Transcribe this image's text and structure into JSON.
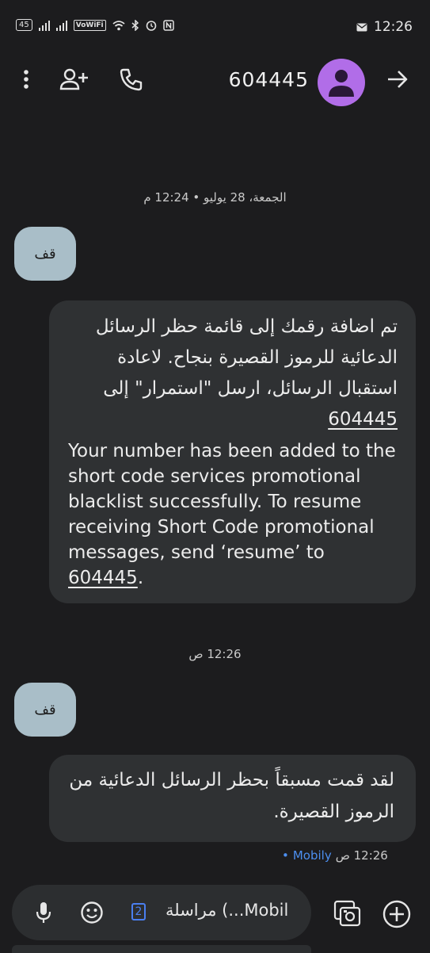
{
  "status_bar": {
    "time": "12:26",
    "badge": "45",
    "vowifi": "VoWiFi",
    "icons": [
      "signal-bars-icon",
      "signal-bars-icon",
      "wifi-icon",
      "bluetooth-icon",
      "alarm-icon",
      "nfc-icon",
      "message-icon"
    ]
  },
  "header": {
    "title": "604445",
    "icons": [
      "more-vert-icon",
      "add-person-icon",
      "phone-icon",
      "avatar-icon",
      "forward-arrow-icon"
    ]
  },
  "messages": [
    {
      "type": "date",
      "text": "الجمعة، 28 يوليو • 12:24 م"
    },
    {
      "type": "sent",
      "text": "قف"
    },
    {
      "type": "received",
      "arabic_text": "تم اضافة رقمك إلى قائمة حظر الرسائل الدعائية للرموز القصيرة بنجاح. لاعادة استقبال الرسائل، ارسل \"استمرار\" إلى",
      "arabic_number": "604445",
      "english_text": "Your number has been added to the short code services promotional blacklist successfully. To resume receiving Short Code promotional messages, send ‘resume’ to",
      "english_number": "604445",
      "english_suffix": "."
    },
    {
      "type": "date",
      "text": "12:26 ص"
    },
    {
      "type": "sent",
      "text": "قف"
    },
    {
      "type": "received",
      "text": "لقد قمت مسبقاً بحظر الرسائل الدعائية من الرموز القصيرة."
    },
    {
      "type": "meta",
      "time": "12:26 ص",
      "separator": "•",
      "carrier": "Mobily"
    }
  ],
  "compose": {
    "sim_number": "2",
    "placeholder": "مراسلة (...Mobil",
    "icons": [
      "mic-icon",
      "emoji-icon",
      "sim-card-icon",
      "gallery-icon",
      "add-icon"
    ]
  },
  "colors": {
    "background": "#1c1c1e",
    "bubble_received": "#2f3133",
    "bubble_sent": "#a9bec8",
    "avatar": "#b16de8",
    "accent": "#4c8ff0"
  }
}
